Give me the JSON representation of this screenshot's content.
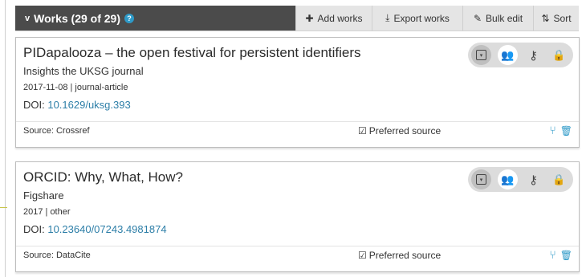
{
  "header": {
    "chevron": "v",
    "title": "Works (29 of 29)",
    "help": "?",
    "add_works": "Add works",
    "export_works": "Export works",
    "bulk_edit": "Bulk edit",
    "sort": "Sort"
  },
  "works": [
    {
      "title": "PIDapalooza – the open festival for persistent identifiers",
      "journal": "Insights the UKSG journal",
      "meta": "2017-11-08 | journal-article",
      "doi_label": "DOI: ",
      "doi": "10.1629/uksg.393",
      "source": "Source: Crossref",
      "preferred": "Preferred source"
    },
    {
      "title": "ORCID: Why, What, How?",
      "journal": "Figshare",
      "meta": "2017 | other",
      "doi_label": "DOI: ",
      "doi": "10.23640/07243.4981874",
      "source": "Source: DataCite",
      "preferred": "Preferred source"
    }
  ],
  "icons": {
    "add": "plus-icon",
    "export": "download-icon",
    "bulk": "pencil-icon",
    "sort": "sort-icon",
    "privacy": [
      "toggle-icon",
      "everyone-icon",
      "trusted-parties-icon",
      "private-lock-icon"
    ],
    "actions": [
      "branch-icon",
      "trash-icon"
    ]
  },
  "colors": {
    "header_dark": "#4b4b4b",
    "link": "#2e7fa8",
    "everyone_green": "#2a9d35",
    "action_blue": "#2e9ac8"
  }
}
